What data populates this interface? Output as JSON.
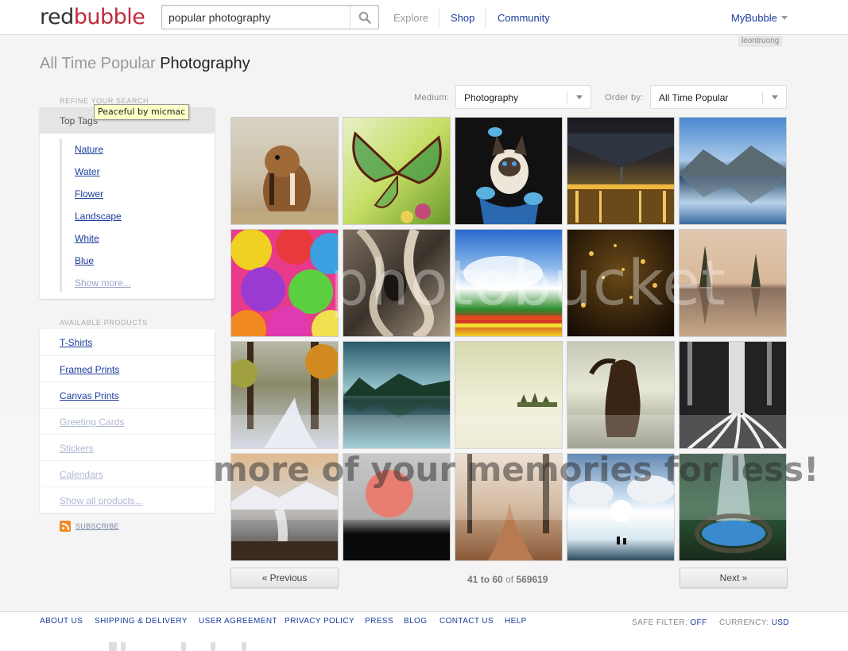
{
  "header": {
    "logo_part1": "red",
    "logo_part2": "bubble",
    "search_value": "popular photography",
    "nav": [
      "Explore",
      "Shop",
      "Community"
    ],
    "account": "MyBubble",
    "username": "leontruong"
  },
  "title": {
    "light": "All Time Popular",
    "dark": "Photography"
  },
  "sidebar": {
    "refine_heading": "REFINE YOUR SEARCH",
    "tags_heading": "Top Tags",
    "tooltip": "Peaceful by micmac",
    "tags": [
      "Nature",
      "Water",
      "Flower",
      "Landscape",
      "White",
      "Blue",
      "Show more..."
    ],
    "products_heading": "AVAILABLE PRODUCTS",
    "products": [
      "T-Shirts",
      "Framed Prints",
      "Canvas Prints",
      "Greeting Cards",
      "Stickers",
      "Calendars",
      "Show all products..."
    ],
    "subscribe": "SUBSCRIBE"
  },
  "filters": {
    "medium_label": "Medium:",
    "medium_value": "Photography",
    "order_label": "Order by:",
    "order_value": "All Time Popular"
  },
  "gallery": {
    "thumbnails": [
      "chipmunk",
      "glasswing-butterfly",
      "kitten-with-birds",
      "bridge-night-lights",
      "mountain-lake-reflection",
      "paper-umbrellas",
      "tree-bark-face",
      "tulip-field-sky",
      "golden-bokeh",
      "misty-trees-lake",
      "autumn-forest-road",
      "blue-lake-reflection",
      "island-mist",
      "horse-sky",
      "black-white-tree-roots",
      "waterfall-mountains",
      "red-moon",
      "autumn-path",
      "sunset-clouds-couple",
      "forest-cave-pool"
    ]
  },
  "pagination": {
    "prev": "« Previous",
    "next": "Next »",
    "from": "41",
    "to_word": "to",
    "to": "60",
    "of_word": "of",
    "total": "569619"
  },
  "watermark": {
    "brand": "photobucket",
    "tagline": "more of your memories for less!"
  },
  "footer": {
    "links": [
      "ABOUT US",
      "SHIPPING & DELIVERY",
      "USER AGREEMENT",
      "PRIVACY POLICY",
      "PRESS",
      "BLOG",
      "CONTACT US",
      "HELP"
    ],
    "safe_label": "SAFE FILTER:",
    "safe_value": "OFF",
    "currency_label": "CURRENCY:",
    "currency_value": "USD"
  }
}
